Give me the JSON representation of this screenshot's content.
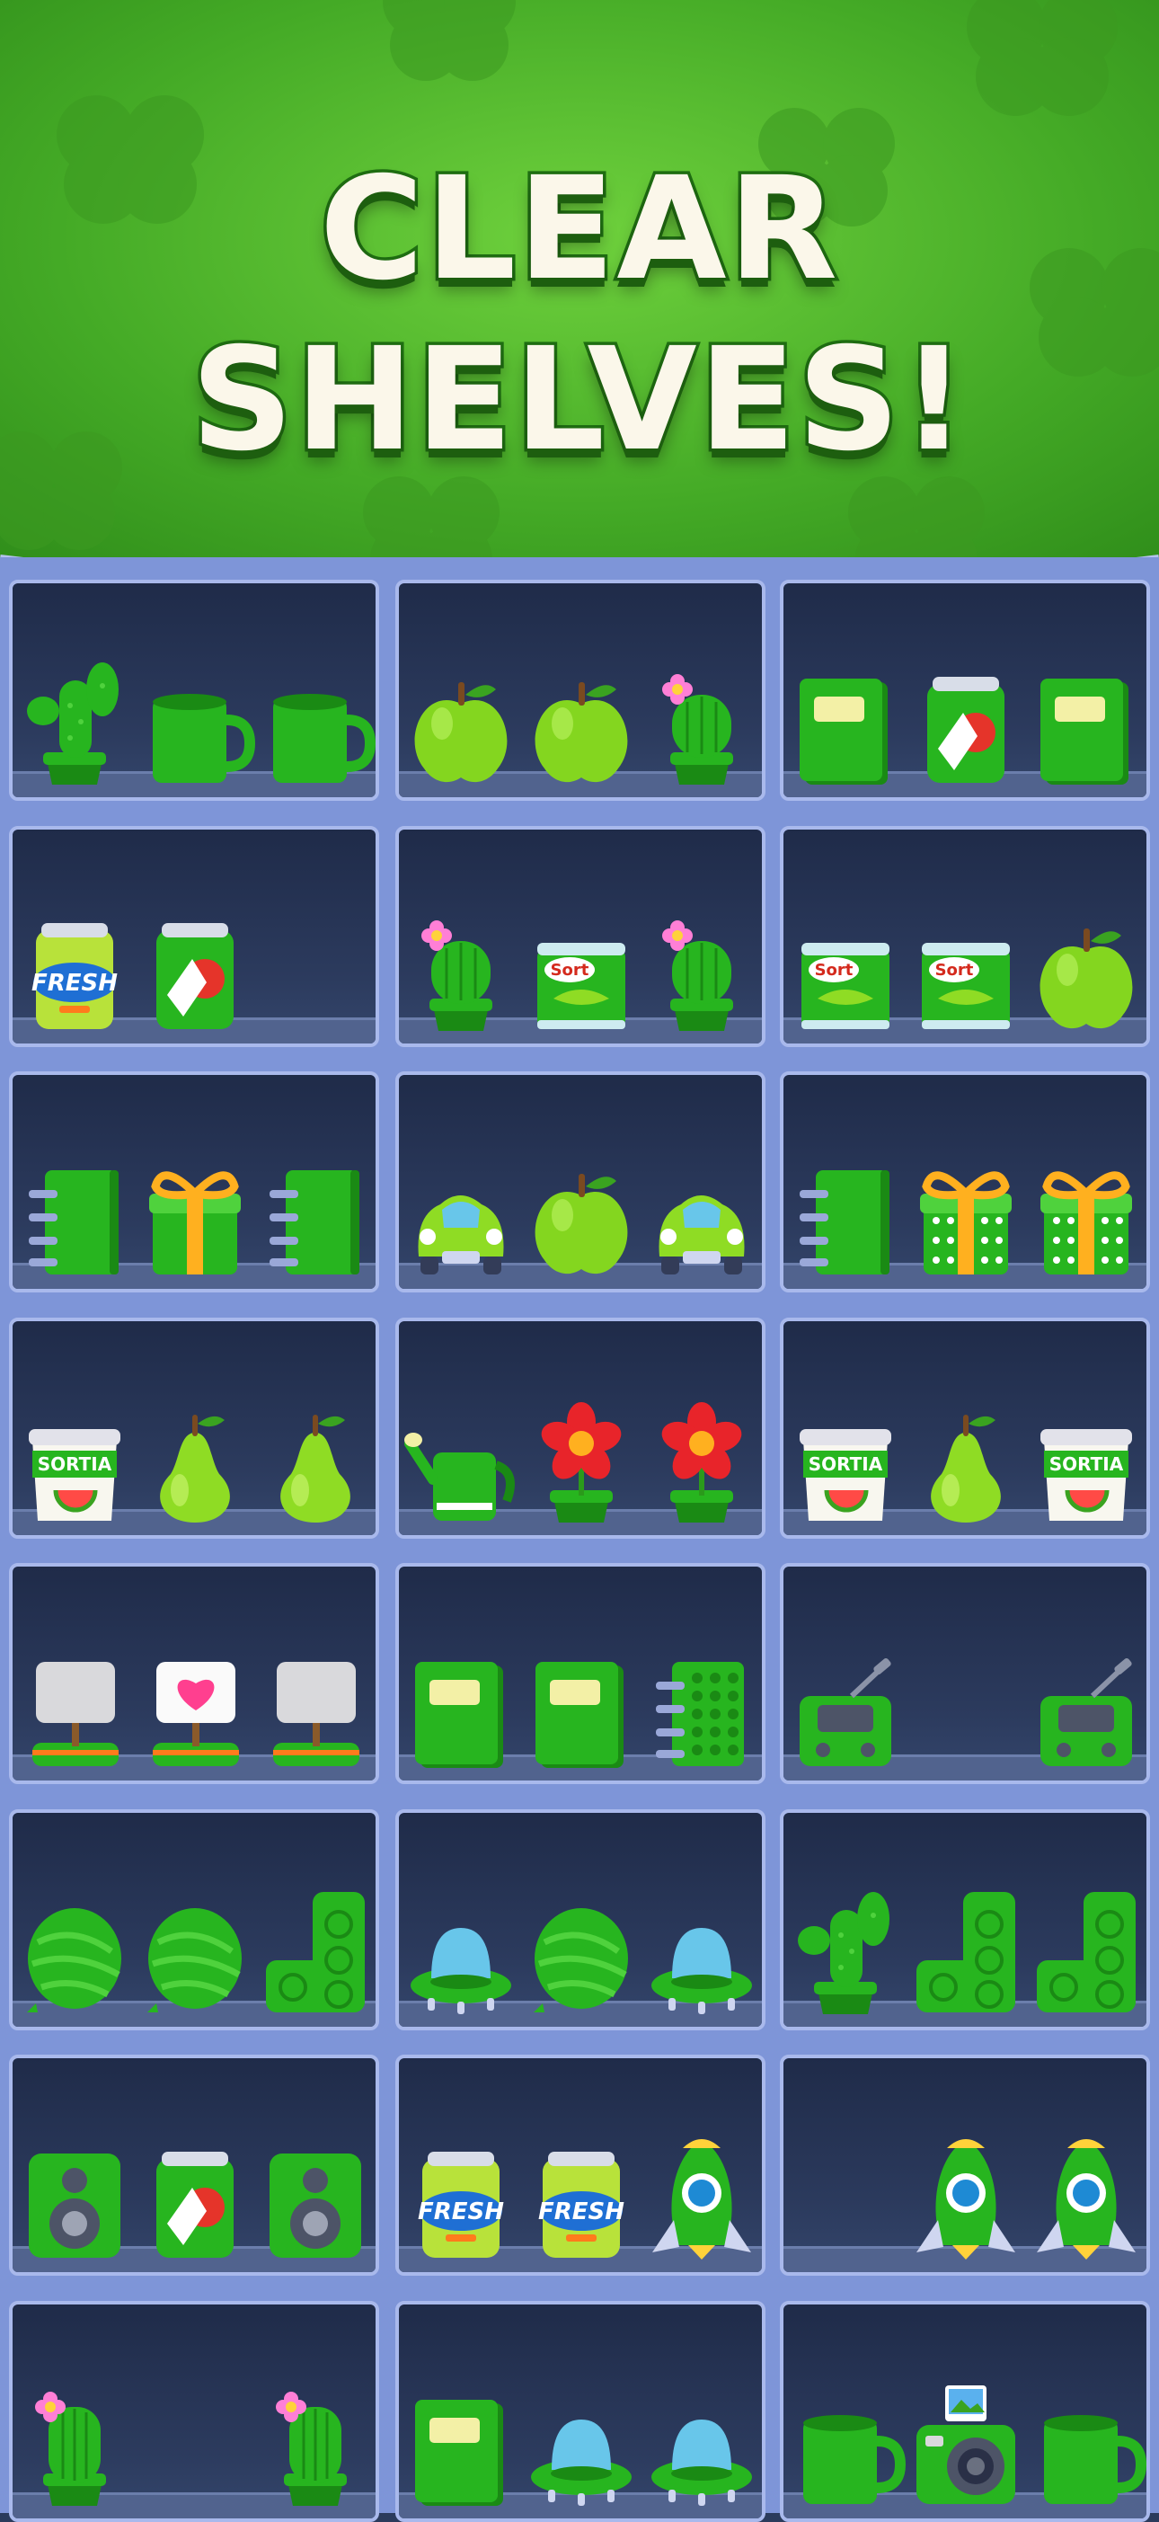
{
  "banner": {
    "title_line1": "CLEAR",
    "title_line2": "SHELVES!"
  },
  "colors": {
    "banner_green": "#3fa321",
    "banner_light": "#5bc23a",
    "shelf_dark": "#243254",
    "shelf_frame": "#7e95d8",
    "item_green": "#27b51f"
  },
  "shelves": [
    {
      "items": [
        {
          "kind": "cactus-tall"
        },
        {
          "kind": "mug"
        },
        {
          "kind": "mug"
        }
      ]
    },
    {
      "items": [
        {
          "kind": "apple"
        },
        {
          "kind": "apple"
        },
        {
          "kind": "cactus-flower"
        }
      ]
    },
    {
      "items": [
        {
          "kind": "book",
          "label": ""
        },
        {
          "kind": "can-heart"
        },
        {
          "kind": "book",
          "label": ""
        }
      ]
    },
    {
      "items": [
        {
          "kind": "can-fresh",
          "label": "FRESH"
        },
        {
          "kind": "can-heart"
        },
        {
          "kind": "empty"
        }
      ]
    },
    {
      "items": [
        {
          "kind": "cactus-flower"
        },
        {
          "kind": "tin-sort",
          "label": "Sort"
        },
        {
          "kind": "cactus-flower"
        }
      ]
    },
    {
      "items": [
        {
          "kind": "tin-sort",
          "label": "Sort"
        },
        {
          "kind": "tin-sort",
          "label": "Sort"
        },
        {
          "kind": "apple"
        }
      ]
    },
    {
      "items": [
        {
          "kind": "notebook"
        },
        {
          "kind": "gift"
        },
        {
          "kind": "notebook"
        }
      ]
    },
    {
      "items": [
        {
          "kind": "car"
        },
        {
          "kind": "apple"
        },
        {
          "kind": "car"
        }
      ]
    },
    {
      "items": [
        {
          "kind": "notebook"
        },
        {
          "kind": "gift-dots"
        },
        {
          "kind": "gift-dots"
        }
      ]
    },
    {
      "items": [
        {
          "kind": "yogurt",
          "label": "SORTIA"
        },
        {
          "kind": "pear"
        },
        {
          "kind": "pear"
        }
      ]
    },
    {
      "items": [
        {
          "kind": "watering-can"
        },
        {
          "kind": "flower"
        },
        {
          "kind": "flower"
        }
      ]
    },
    {
      "items": [
        {
          "kind": "yogurt",
          "label": "SORTIA"
        },
        {
          "kind": "pear"
        },
        {
          "kind": "yogurt",
          "label": "SORTIA"
        }
      ]
    },
    {
      "items": [
        {
          "kind": "sign"
        },
        {
          "kind": "sign-heart"
        },
        {
          "kind": "sign"
        }
      ]
    },
    {
      "items": [
        {
          "kind": "book",
          "label": ""
        },
        {
          "kind": "book",
          "label": ""
        },
        {
          "kind": "notebook-dots"
        }
      ]
    },
    {
      "items": [
        {
          "kind": "radio"
        },
        {
          "kind": "empty"
        },
        {
          "kind": "radio"
        }
      ]
    },
    {
      "items": [
        {
          "kind": "balloon"
        },
        {
          "kind": "balloon"
        },
        {
          "kind": "block-l"
        }
      ]
    },
    {
      "items": [
        {
          "kind": "ufo"
        },
        {
          "kind": "balloon"
        },
        {
          "kind": "ufo"
        }
      ]
    },
    {
      "items": [
        {
          "kind": "cactus-tall"
        },
        {
          "kind": "block-l"
        },
        {
          "kind": "block-l"
        }
      ]
    },
    {
      "items": [
        {
          "kind": "speaker"
        },
        {
          "kind": "can-heart"
        },
        {
          "kind": "speaker"
        }
      ]
    },
    {
      "items": [
        {
          "kind": "can-fresh",
          "label": "FRESH"
        },
        {
          "kind": "can-fresh",
          "label": "FRESH"
        },
        {
          "kind": "rocket"
        }
      ]
    },
    {
      "items": [
        {
          "kind": "empty"
        },
        {
          "kind": "rocket"
        },
        {
          "kind": "rocket"
        }
      ]
    },
    {
      "items": [
        {
          "kind": "cactus-column"
        },
        {
          "kind": "empty"
        },
        {
          "kind": "cactus-column"
        }
      ]
    },
    {
      "items": [
        {
          "kind": "book",
          "label": ""
        },
        {
          "kind": "ufo"
        },
        {
          "kind": "ufo"
        }
      ]
    },
    {
      "items": [
        {
          "kind": "mug"
        },
        {
          "kind": "camera"
        },
        {
          "kind": "mug"
        }
      ]
    }
  ]
}
